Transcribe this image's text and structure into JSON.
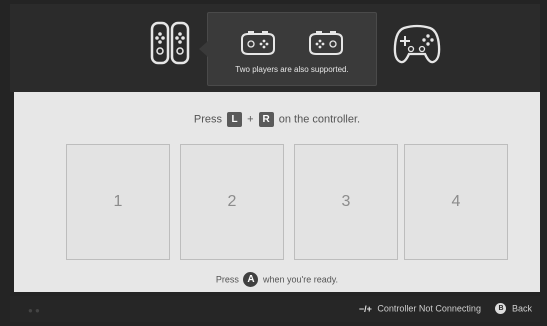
{
  "tooltip": {
    "text": "Two players are also supported."
  },
  "instructions": {
    "press_word": "Press",
    "key_left": "L",
    "plus": "+",
    "key_right": "R",
    "rest": "on the controller."
  },
  "slots": [
    {
      "label": "1"
    },
    {
      "label": "2"
    },
    {
      "label": "3"
    },
    {
      "label": "4"
    }
  ],
  "ready": {
    "press_word": "Press",
    "button": "A",
    "rest": "when you're ready."
  },
  "footer": {
    "minus_plus": "−/+",
    "not_connecting": "Controller Not Connecting",
    "back_button": "B",
    "back": "Back"
  },
  "icons": [
    "joycon-pair-icon",
    "joycon-horizontal-icon",
    "pro-controller-icon"
  ]
}
